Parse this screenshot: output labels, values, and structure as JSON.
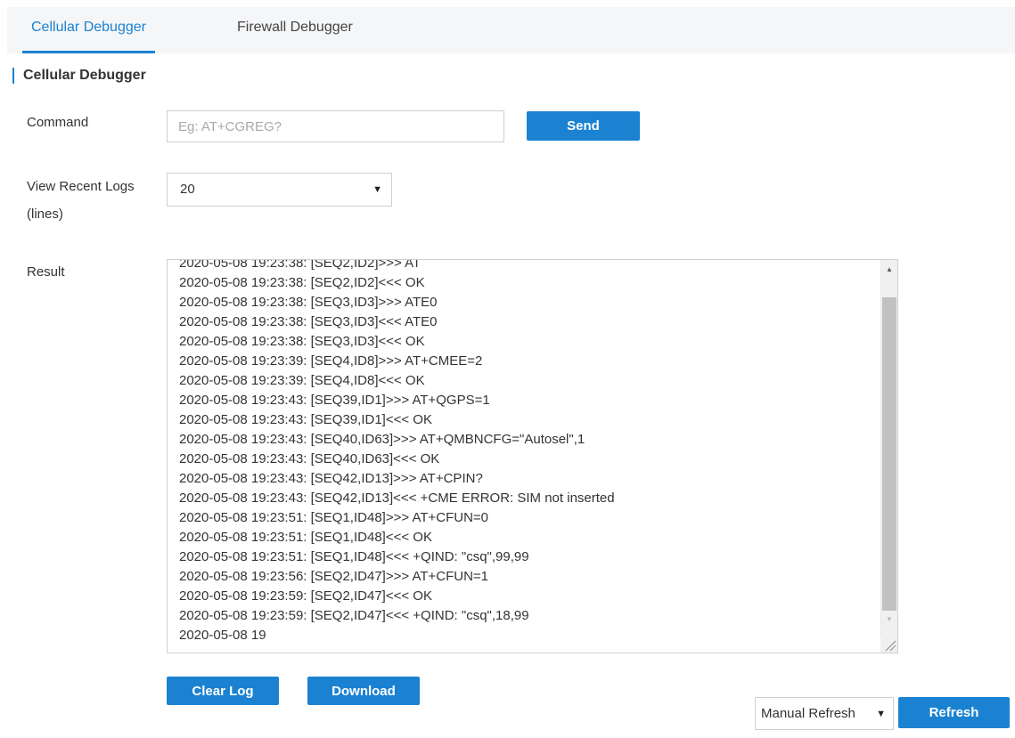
{
  "tabs": [
    {
      "label": "Cellular Debugger"
    },
    {
      "label": "Firewall Debugger"
    }
  ],
  "section_title": "Cellular Debugger",
  "command": {
    "label": "Command",
    "placeholder": "Eg: AT+CGREG?",
    "value": "",
    "send_label": "Send"
  },
  "logs": {
    "label_line1": "View Recent Logs",
    "label_line2": "(lines)",
    "selected": "20"
  },
  "result": {
    "label": "Result",
    "text": "2020-05-08 19:23:38: [SEQ2,ID2]>>> AT\n2020-05-08 19:23:38: [SEQ2,ID2]<<< OK\n2020-05-08 19:23:38: [SEQ3,ID3]>>> ATE0\n2020-05-08 19:23:38: [SEQ3,ID3]<<< ATE0\n2020-05-08 19:23:38: [SEQ3,ID3]<<< OK\n2020-05-08 19:23:39: [SEQ4,ID8]>>> AT+CMEE=2\n2020-05-08 19:23:39: [SEQ4,ID8]<<< OK\n2020-05-08 19:23:43: [SEQ39,ID1]>>> AT+QGPS=1\n2020-05-08 19:23:43: [SEQ39,ID1]<<< OK\n2020-05-08 19:23:43: [SEQ40,ID63]>>> AT+QMBNCFG=\"Autosel\",1\n2020-05-08 19:23:43: [SEQ40,ID63]<<< OK\n2020-05-08 19:23:43: [SEQ42,ID13]>>> AT+CPIN?\n2020-05-08 19:23:43: [SEQ42,ID13]<<< +CME ERROR: SIM not inserted\n2020-05-08 19:23:51: [SEQ1,ID48]>>> AT+CFUN=0\n2020-05-08 19:23:51: [SEQ1,ID48]<<< OK\n2020-05-08 19:23:51: [SEQ1,ID48]<<< +QIND: \"csq\",99,99\n2020-05-08 19:23:56: [SEQ2,ID47]>>> AT+CFUN=1\n2020-05-08 19:23:59: [SEQ2,ID47]<<< OK\n2020-05-08 19:23:59: [SEQ2,ID47]<<< +QIND: \"csq\",18,99\n2020-05-08 19"
  },
  "actions": {
    "clear_label": "Clear Log",
    "download_label": "Download",
    "refresh_mode": "Manual Refresh",
    "refresh_label": "Refresh"
  },
  "colors": {
    "accent": "#1b82d2",
    "tab_bar_bg": "#f5f6f8",
    "border": "#cfcfcf"
  }
}
